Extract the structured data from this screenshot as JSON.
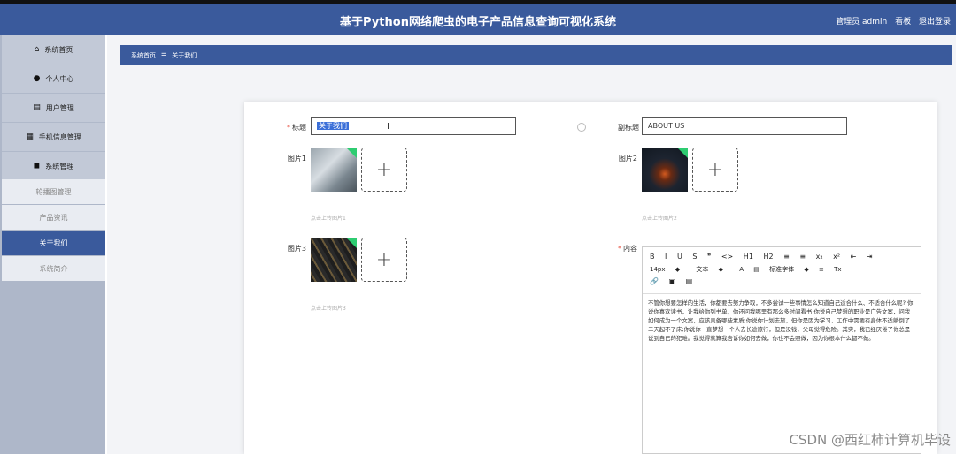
{
  "header": {
    "title": "基于Python网络爬虫的电子产品信息查询可视化系统",
    "user": "管理员 admin",
    "board": "看板",
    "logout": "退出登录"
  },
  "sidebar": {
    "items": [
      {
        "label": "系统首页",
        "icon": "home-icon"
      },
      {
        "label": "个人中心",
        "icon": "user-icon"
      },
      {
        "label": "用户管理",
        "icon": "users-icon"
      },
      {
        "label": "手机信息管理",
        "icon": "grid-icon"
      },
      {
        "label": "系统管理",
        "icon": "settings-icon"
      }
    ],
    "subitems": [
      {
        "label": "轮播图管理"
      },
      {
        "label": "产品资讯"
      },
      {
        "label": "关于我们"
      },
      {
        "label": "系统简介"
      }
    ]
  },
  "breadcrumb": {
    "home": "系统首页",
    "sep": "☰",
    "current": "关于我们"
  },
  "form": {
    "title_label": "标题",
    "title_value": "关于我们",
    "subtitle_label": "副标题",
    "subtitle_value": "ABOUT US",
    "image1_label": "图片1",
    "image1_hint": "点击上传图片1",
    "image2_label": "图片2",
    "image2_hint": "点击上传图片2",
    "image3_label": "图片3",
    "image3_hint": "点击上传图片3",
    "content_label": "内容",
    "required_mark": "*",
    "upload_plus": "+"
  },
  "editor": {
    "toolbar_row1": [
      "B",
      "I",
      "U",
      "S",
      "❞",
      "<>",
      "H1",
      "H2",
      "≡",
      "≡",
      "x₂",
      "x²",
      "⇤",
      "⇥"
    ],
    "toolbar_row2": [
      "14px",
      "◆",
      "文本",
      "◆",
      "A",
      "▤",
      "标准字体",
      "◆",
      "≡",
      "Tx"
    ],
    "toolbar_row3": [
      "🔗",
      "▣",
      "▤"
    ],
    "body": "不管你想要怎样的生活，你都要去努力争取，不多尝试一些事情怎么知道自己适合什么、不适合什么呢? 你说你喜欢读书，让我给你列书单，你还问我哪里有那么多时间看书;你说自己梦想的职业是广告文案，问我如何成为一个文案，应该具备哪些素质;你说你计划去旅，但你是因为学习、工作中需要有身体不适躺倒了二天起不了床;你说你一直梦想一个人去长途旅行，但是没钱，父母觉得危险。其实，我已经厌倦了你总是说到自己的犯难。我觉得就算我告诉你如何去做，你也不会照做，因为你根本什么都不做。"
  },
  "watermark": "CSDN @西红柿计算机毕设",
  "colors": {
    "accent": "#3a5a9c",
    "sidebar": "#aeb7c9",
    "corner_badge": "#2ecc71"
  }
}
